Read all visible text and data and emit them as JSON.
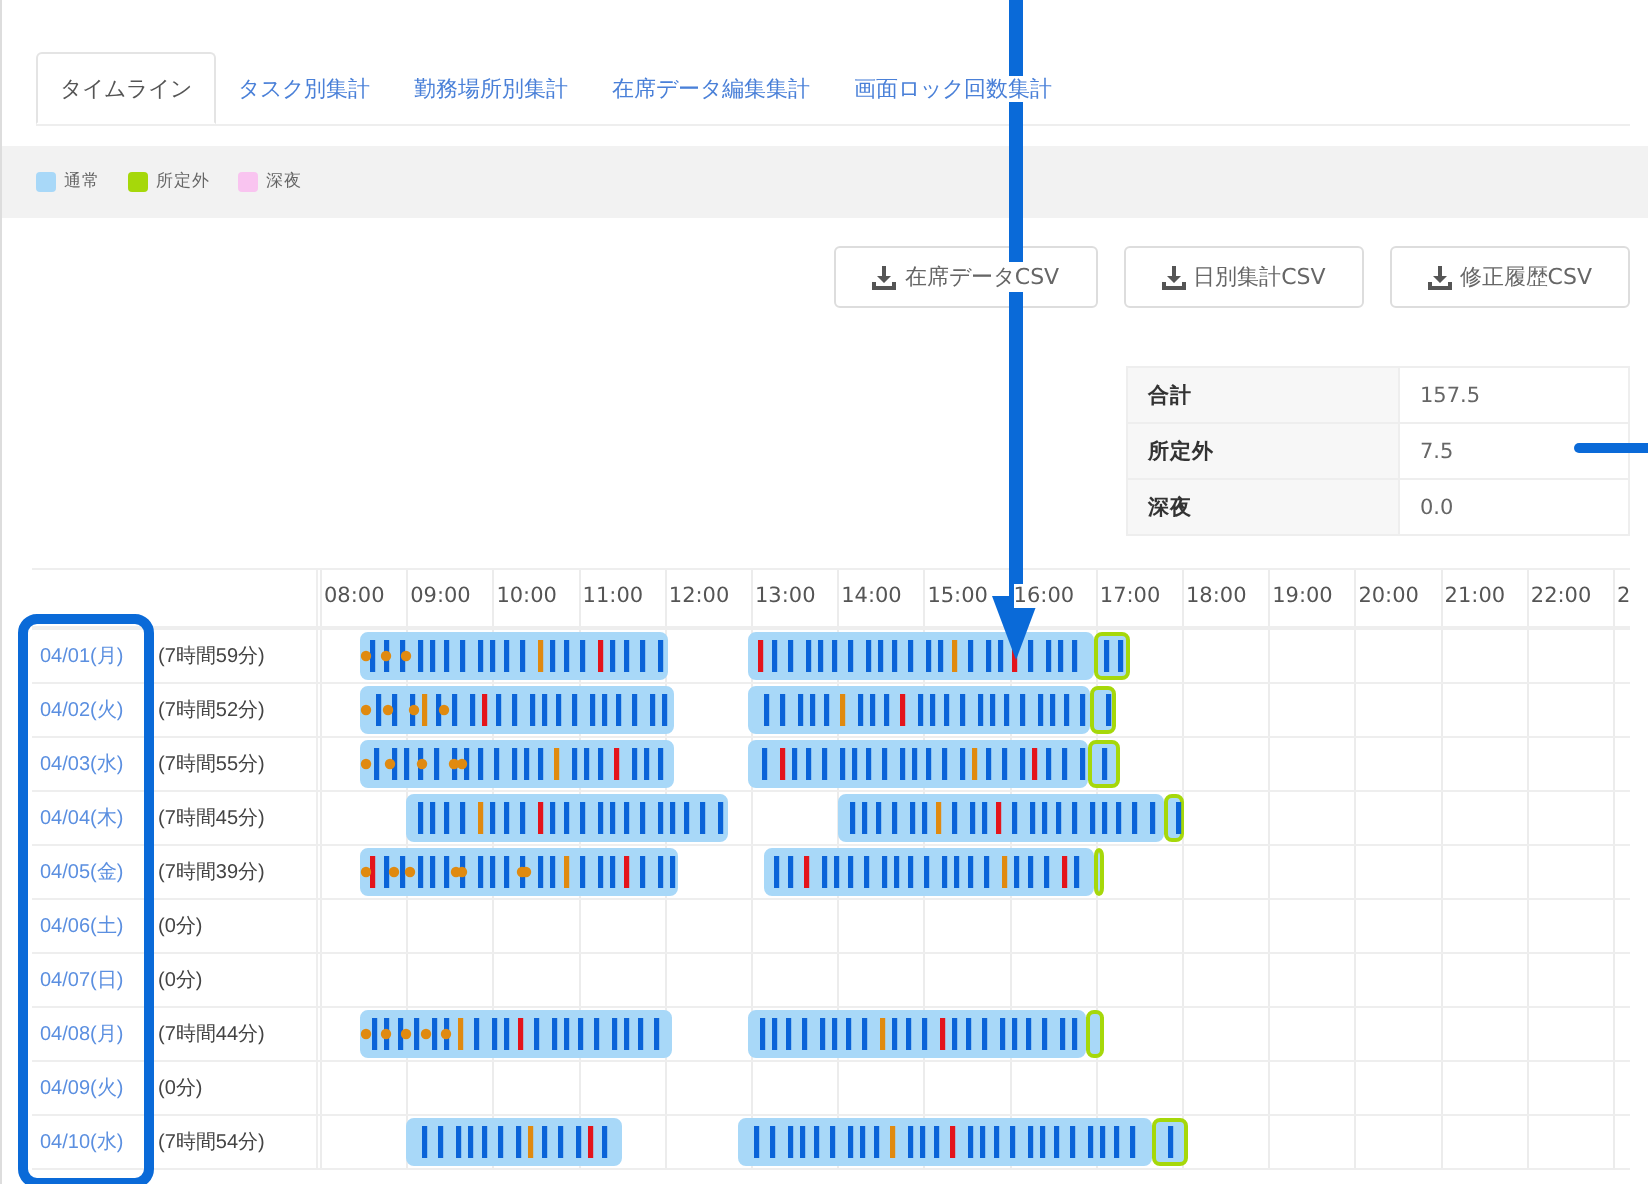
{
  "tabs": [
    {
      "label": "タイムライン",
      "selected": true
    },
    {
      "label": "タスク別集計",
      "selected": false
    },
    {
      "label": "勤務場所別集計",
      "selected": false
    },
    {
      "label": "在席データ編集集計",
      "selected": false
    },
    {
      "label": "画面ロック回数集計",
      "selected": false
    }
  ],
  "legend": [
    {
      "label": "通常",
      "color": "#a8d8f8"
    },
    {
      "label": "所定外",
      "color": "#a6d80a"
    },
    {
      "label": "深夜",
      "color": "#f9c4f0"
    }
  ],
  "buttons": [
    {
      "label": "在席データCSV"
    },
    {
      "label": "日別集計CSV"
    },
    {
      "label": "修正履歴CSV"
    }
  ],
  "summary": [
    {
      "label": "合計",
      "value": "157.5"
    },
    {
      "label": "所定外",
      "value": "7.5"
    },
    {
      "label": "深夜",
      "value": "0.0"
    }
  ],
  "timeline": {
    "hours": [
      "08:00",
      "09:00",
      "10:00",
      "11:00",
      "12:00",
      "13:00",
      "14:00",
      "15:00",
      "16:00",
      "17:00",
      "18:00",
      "19:00",
      "20:00",
      "21:00",
      "22:00",
      "2"
    ],
    "rows": [
      {
        "date": "04/01(月)",
        "total": "(7時間59分)",
        "kind": "work"
      },
      {
        "date": "04/02(火)",
        "total": "(7時間52分)",
        "kind": "work"
      },
      {
        "date": "04/03(水)",
        "total": "(7時間55分)",
        "kind": "work"
      },
      {
        "date": "04/04(木)",
        "total": "(7時間45分)",
        "kind": "work"
      },
      {
        "date": "04/05(金)",
        "total": "(7時間39分)",
        "kind": "work"
      },
      {
        "date": "04/06(土)",
        "total": "(0分)",
        "kind": "off"
      },
      {
        "date": "04/07(日)",
        "total": "(0分)",
        "kind": "off"
      },
      {
        "date": "04/08(月)",
        "total": "(7時間44分)",
        "kind": "work"
      },
      {
        "date": "04/09(火)",
        "total": "(0分)",
        "kind": "off"
      },
      {
        "date": "04/10(水)",
        "total": "(7時間54分)",
        "kind": "work"
      }
    ]
  }
}
